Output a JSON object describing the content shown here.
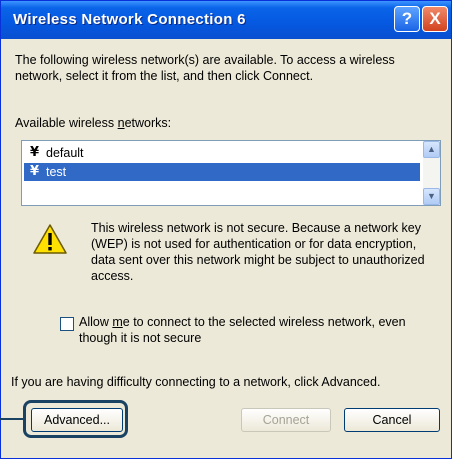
{
  "window": {
    "title": "Wireless Network Connection 6",
    "help_label": "?",
    "close_label": "X"
  },
  "intro": {
    "text": "The following wireless network(s) are available. To access a wireless network, select it from the list, and then click Connect."
  },
  "networks": {
    "label_prefix": "Available wireless ",
    "label_underlined": "n",
    "label_suffix": "etworks:",
    "items": [
      {
        "ssid": "default",
        "selected": false
      },
      {
        "ssid": "test",
        "selected": true
      }
    ],
    "antenna_glyph": "¥",
    "scroll_up": "▲",
    "scroll_down": "▼"
  },
  "warning": {
    "icon": "warning-triangle-icon",
    "text": "This wireless network is not secure. Because a network key (WEP) is not used for authentication or for data encryption, data sent over this network might be subject to unauthorized access."
  },
  "allow": {
    "checked": false,
    "text_prefix": "Allow ",
    "text_underlined": "m",
    "text_suffix": "e to connect to the selected wireless network, even though it is not secure"
  },
  "difficulty": {
    "text": "If you are having difficulty connecting to a network, click Advanced."
  },
  "buttons": {
    "advanced": "Advanced...",
    "connect": "Connect",
    "cancel": "Cancel",
    "connect_enabled": false
  },
  "colors": {
    "titlebar": "#0558e0",
    "selection": "#3169c6",
    "callout": "#1a4263",
    "warning_fill": "#ffe000"
  }
}
